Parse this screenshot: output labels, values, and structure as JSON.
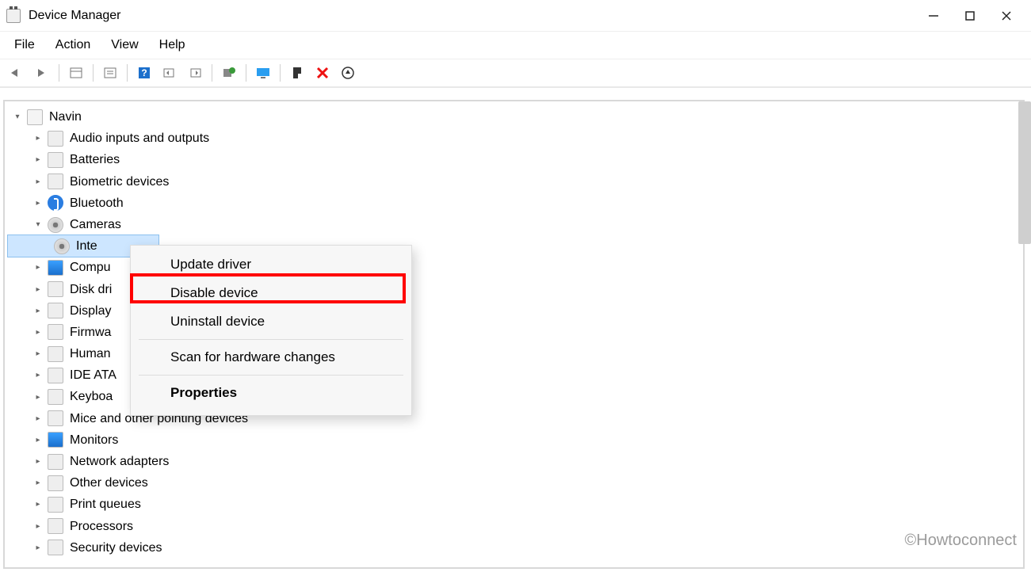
{
  "window": {
    "title": "Device Manager"
  },
  "menu": {
    "file": "File",
    "action": "Action",
    "view": "View",
    "help": "Help"
  },
  "toolbar_icons": {
    "back": "back-icon",
    "forward": "forward-icon",
    "show_hidden": "show-hidden-icon",
    "properties": "properties-icon",
    "help": "help-icon",
    "scan_prev": "scan-prev-icon",
    "scan_next": "scan-next-icon",
    "update": "update-driver-icon",
    "monitor": "monitor-icon",
    "enable": "enable-device-icon",
    "remove": "remove-device-icon",
    "scan_hw": "scan-hardware-icon"
  },
  "tree": {
    "root": {
      "label": "Navin",
      "expanded": true
    },
    "children": [
      {
        "label": "Audio inputs and outputs",
        "expanded": false,
        "icon": "speaker"
      },
      {
        "label": "Batteries",
        "expanded": false,
        "icon": "battery"
      },
      {
        "label": "Biometric devices",
        "expanded": false,
        "icon": "fingerprint"
      },
      {
        "label": "Bluetooth",
        "expanded": false,
        "icon": "bt"
      },
      {
        "label": "Cameras",
        "expanded": true,
        "icon": "cam",
        "children": [
          {
            "label": "Integrated Camera",
            "selected": true,
            "truncated_label": "Inte",
            "icon": "cam"
          }
        ]
      },
      {
        "label": "Computer",
        "truncated_label": "Compu",
        "expanded": false,
        "icon": "mon"
      },
      {
        "label": "Disk drives",
        "truncated_label": "Disk dri",
        "expanded": false,
        "icon": "disk"
      },
      {
        "label": "Display adapters",
        "truncated_label": "Display",
        "expanded": false,
        "icon": "display"
      },
      {
        "label": "Firmware",
        "truncated_label": "Firmwa",
        "expanded": false,
        "icon": "chip"
      },
      {
        "label": "Human Interface Devices",
        "truncated_label": "Human",
        "expanded": false,
        "icon": "hid"
      },
      {
        "label": "IDE ATA/ATAPI controllers",
        "truncated_label": "IDE ATA",
        "expanded": false,
        "icon": "ide"
      },
      {
        "label": "Keyboards",
        "truncated_label": "Keyboa",
        "expanded": false,
        "icon": "keyboard"
      },
      {
        "label": "Mice and other pointing devices",
        "expanded": false,
        "icon": "mouse"
      },
      {
        "label": "Monitors",
        "expanded": false,
        "icon": "mon"
      },
      {
        "label": "Network adapters",
        "expanded": false,
        "icon": "net"
      },
      {
        "label": "Other devices",
        "expanded": false,
        "icon": "other"
      },
      {
        "label": "Print queues",
        "expanded": false,
        "icon": "printer"
      },
      {
        "label": "Processors",
        "expanded": false,
        "icon": "cpu"
      },
      {
        "label": "Security devices",
        "expanded": false,
        "icon": "security"
      }
    ]
  },
  "context_menu": {
    "update_driver": "Update driver",
    "disable_device": "Disable device",
    "uninstall_device": "Uninstall device",
    "scan_hw": "Scan for hardware changes",
    "properties": "Properties",
    "highlighted": "disable_device"
  },
  "watermark": "©Howtoconnect"
}
